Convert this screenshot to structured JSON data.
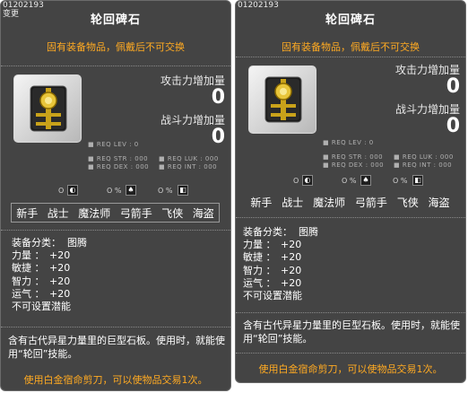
{
  "panels": [
    {
      "code": "01202193",
      "subcode": "变更",
      "title": "轮回碑石",
      "notice": "固有装备物品，佩戴后不可交换",
      "stats": [
        {
          "label": "攻击力增加量",
          "value": "0"
        },
        {
          "label": "战斗力增加量",
          "value": "0"
        }
      ],
      "req": {
        "lev": "■ REQ LEV :     0",
        "str": "■ REQ STR : 000",
        "luk": "■ REQ LUK : 000",
        "dex": "■ REQ DEX : 000",
        "int": "■ REQ INT : 000"
      },
      "sym": [
        "O",
        "O  %",
        "O  %"
      ],
      "jobs": [
        "新手",
        "战士",
        "魔法师",
        "弓箭手",
        "飞侠",
        "海盗"
      ],
      "info": [
        {
          "k": "装备分类：",
          "v": "图腾"
        },
        {
          "k": "力量 ：",
          "v": "+20"
        },
        {
          "k": "敏捷 ：",
          "v": "+20"
        },
        {
          "k": "智力 ：",
          "v": "+20"
        },
        {
          "k": "运气 ：",
          "v": "+20"
        }
      ],
      "potential": "不可设置潜能",
      "desc": "含有古代异星力量里的巨型石板。使用时，就能使用“轮回”技能。",
      "usage": "使用白金宿命剪刀，可以使物品交易1次。"
    },
    {
      "code": "01202193",
      "subcode": "",
      "title": "轮回碑石",
      "notice": "固有装备物品，佩戴后不可交换",
      "stats": [
        {
          "label": "攻击力增加量",
          "value": "0"
        },
        {
          "label": "战斗力增加量",
          "value": "0"
        }
      ],
      "req": {
        "lev": "■ REQ LEV :     0",
        "str": "■ REQ STR : 000",
        "luk": "■ REQ LUK : 000",
        "dex": "■ REQ DEX : 000",
        "int": "■ REQ INT : 000"
      },
      "sym": [
        "O",
        "O  %",
        "O  %"
      ],
      "jobs": [
        "新手",
        "战士",
        "魔法师",
        "弓箭手",
        "飞侠",
        "海盗"
      ],
      "info": [
        {
          "k": "装备分类：",
          "v": "图腾"
        },
        {
          "k": "力量 ：",
          "v": "+20"
        },
        {
          "k": "敏捷 ：",
          "v": "+20"
        },
        {
          "k": "智力 ：",
          "v": "+20"
        },
        {
          "k": "运气 ：",
          "v": "+20"
        }
      ],
      "potential": "不可设置潜能",
      "desc": "含有古代异星力量里的巨型石板。使用时，就能使用“轮回”技能。",
      "usage": "使用白金宿命剪刀，可以使物品交易1次。"
    }
  ]
}
